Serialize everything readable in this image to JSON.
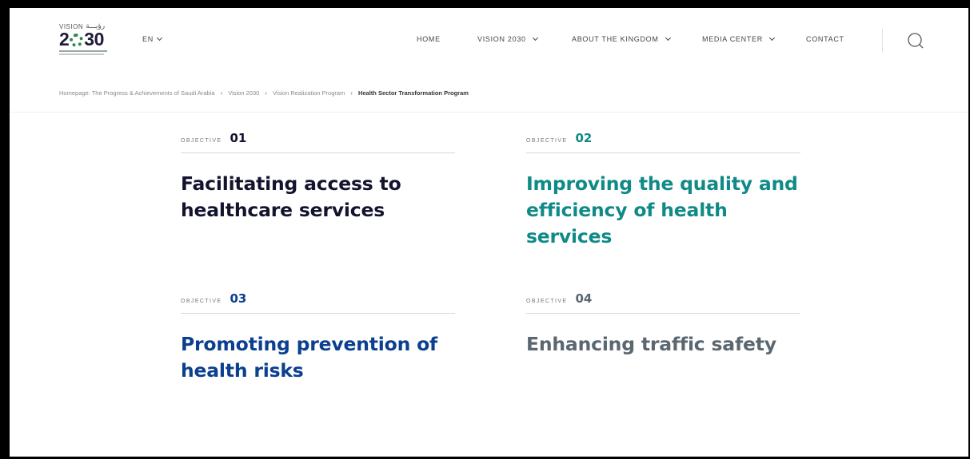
{
  "header": {
    "logo": {
      "top_text": "VISION",
      "arabic_text": "رؤيـــة",
      "year": [
        "2",
        "30"
      ]
    },
    "language": "EN",
    "nav": [
      {
        "label": "HOME",
        "has_dropdown": false
      },
      {
        "label": "VISION 2030",
        "has_dropdown": true
      },
      {
        "label": "ABOUT THE KINGDOM",
        "has_dropdown": true
      },
      {
        "label": "MEDIA CENTER",
        "has_dropdown": true
      },
      {
        "label": "CONTACT",
        "has_dropdown": false
      }
    ],
    "search_icon": "search-icon"
  },
  "breadcrumb": [
    "Homepage: The Progress & Achievements of Saudi Arabia",
    "Vision 2030",
    "Vision Realization Program",
    "Health Sector Transformation Program"
  ],
  "objectives": [
    {
      "label": "OBJECTIVE",
      "number": "01",
      "title": "Facilitating access to healthcare services",
      "color": "#13132e"
    },
    {
      "label": "OBJECTIVE",
      "number": "02",
      "title": "Improving the quality and efficiency of health services",
      "color": "#0f8a87"
    },
    {
      "label": "OBJECTIVE",
      "number": "03",
      "title": "Promoting prevention of health risks",
      "color": "#0b3f8f"
    },
    {
      "label": "OBJECTIVE",
      "number": "04",
      "title": "Enhancing traffic safety",
      "color": "#5b6770"
    }
  ]
}
